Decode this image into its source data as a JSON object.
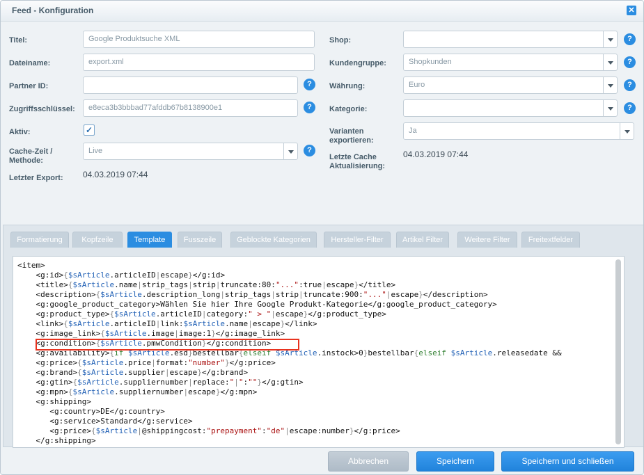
{
  "window": {
    "title": "Feed - Konfiguration",
    "close_icon": "close-icon"
  },
  "form": {
    "titel": {
      "label": "Titel:",
      "value": "Google Produktsuche XML"
    },
    "dateiname": {
      "label": "Dateiname:",
      "value": "export.xml"
    },
    "partner_id": {
      "label": "Partner ID:",
      "value": ""
    },
    "zugriffsschluessel": {
      "label": "Zugriffsschlüssel:",
      "value": "e8eca3b3bbbad77afddb67b8138900e1"
    },
    "aktiv": {
      "label": "Aktiv:",
      "checked": true,
      "check_glyph": "✓"
    },
    "cache": {
      "label_line1": "Cache-Zeit /",
      "label_line2": "Methode:",
      "value": "Live"
    },
    "letzter_export": {
      "label": "Letzter Export:",
      "value": "04.03.2019 07:44"
    },
    "shop": {
      "label": "Shop:",
      "value": ""
    },
    "kundengruppe": {
      "label": "Kundengruppe:",
      "value": "Shopkunden"
    },
    "waehrung": {
      "label": "Währung:",
      "value": "Euro"
    },
    "kategorie": {
      "label": "Kategorie:",
      "value": ""
    },
    "varianten": {
      "label_line1": "Varianten",
      "label_line2": "exportieren:",
      "value": "Ja"
    },
    "letzte_cache": {
      "label_line1": "Letzte Cache",
      "label_line2": "Aktualisierung:",
      "value": "04.03.2019 07:44"
    },
    "help_glyph": "?"
  },
  "tabs": [
    {
      "label": "Formatierung",
      "active": false
    },
    {
      "label": "Kopfzeile",
      "active": false
    },
    {
      "label": "Template",
      "active": true
    },
    {
      "label": "Fusszeile",
      "active": false
    },
    {
      "label": "Geblockte Kategorien",
      "active": false
    },
    {
      "label": "Hersteller-Filter",
      "active": false
    },
    {
      "label": "Artikel Filter",
      "active": false
    },
    {
      "label": "Weitere Filter",
      "active": false
    },
    {
      "label": "Freitextfelder",
      "active": false
    }
  ],
  "template_code": [
    "<item>",
    "    <g:id>{$sArticle.articleID|escape}</g:id>",
    "    <title>{$sArticle.name|strip_tags|strip|truncate:80:\"...\":true|escape}</title>",
    "    <description>{$sArticle.description_long|strip_tags|strip|truncate:900:\"...\"|escape}</description>",
    "    <g:google_product_category>Wählen Sie hier Ihre Google Produkt-Kategorie</g:google_product_category>",
    "    <g:product_type>{$sArticle.articleID|category:\" > \"|escape}</g:product_type>",
    "    <link>{$sArticle.articleID|link:$sArticle.name|escape}</link>",
    "    <g:image_link>{$sArticle.image|image:1}</g:image_link>",
    "    <g:condition>{$sArticle.pmwCondition}</g:condition>",
    "    <g:availability>{if $sArticle.esd}bestellbar{elseif $sArticle.instock>0}bestellbar{elseif $sArticle.releasedate &&",
    "    <g:price>{$sArticle.price|format:\"number\"}</g:price>",
    "    <g:brand>{$sArticle.supplier|escape}</g:brand>",
    "    <g:gtin>{$sArticle.suppliernumber|replace:\"|\":\"\"}</g:gtin>",
    "    <g:mpn>{$sArticle.suppliernumber|escape}</g:mpn>",
    "    <g:shipping>",
    "       <g:country>DE</g:country>",
    "       <g:service>Standard</g:service>",
    "       <g:price>{$sArticle|@shippingcost:\"prepayment\":\"de\"|escape:number}</g:price>",
    "    </g:shipping>"
  ],
  "highlight_color": "#e8331f",
  "buttons": {
    "abbrechen": "Abbrechen",
    "speichern": "Speichern",
    "speichern_schliessen": "Speichern und schließen"
  },
  "colors": {
    "accent": "#2b8de1",
    "tab_inactive": "#c6d2dc"
  }
}
